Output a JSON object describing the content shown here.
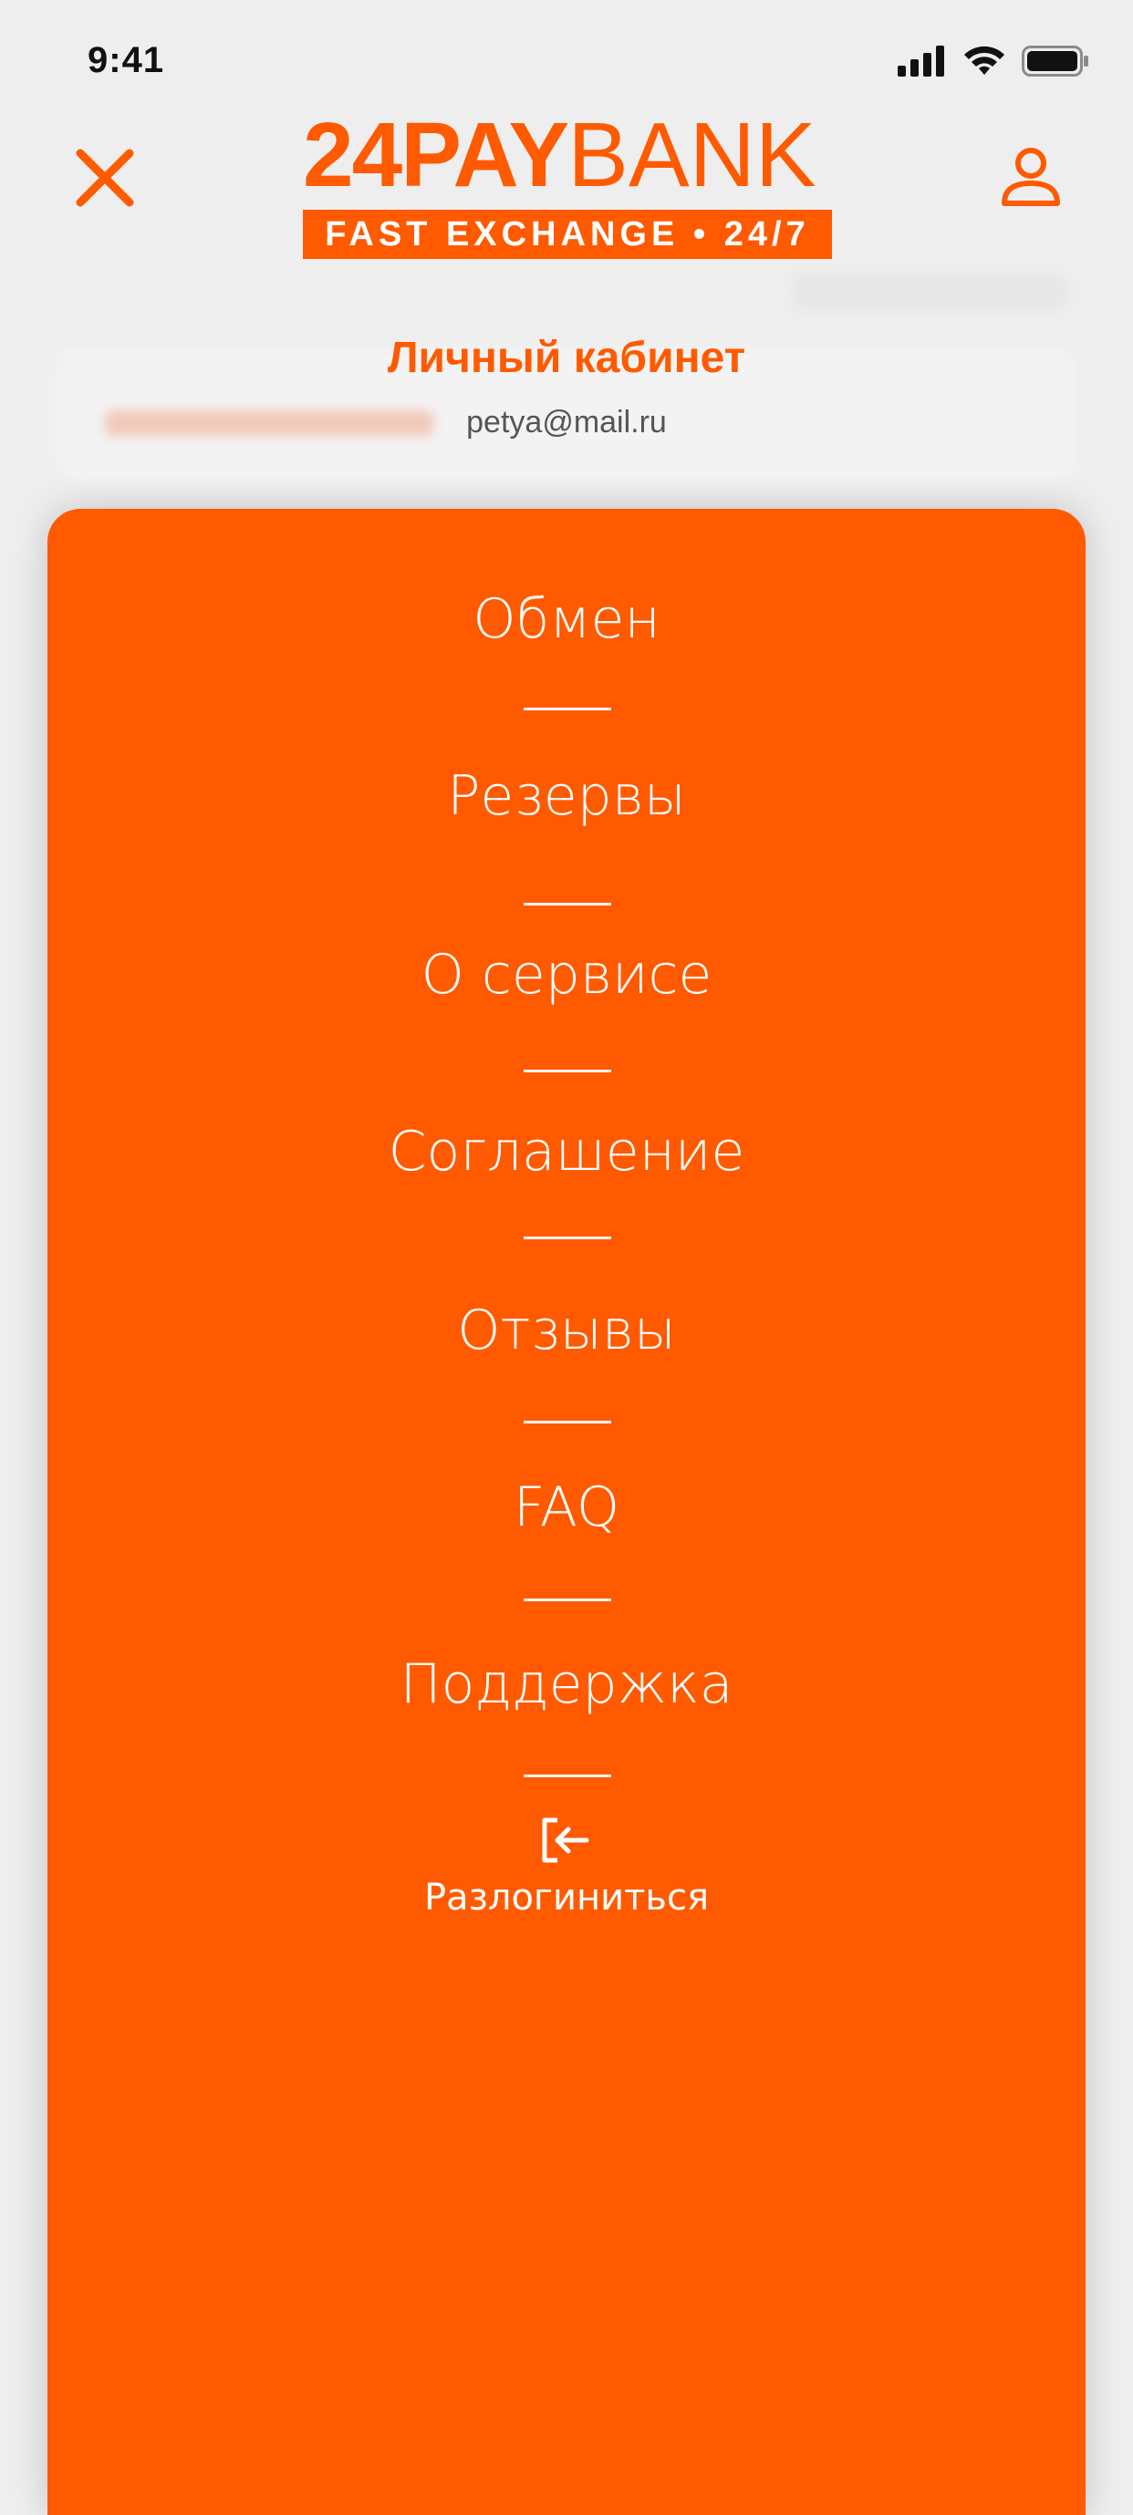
{
  "status_bar": {
    "time": "9:41",
    "icons": [
      "cellular-signal-icon",
      "wifi-icon",
      "battery-icon"
    ]
  },
  "header": {
    "logo": {
      "brand_bold": "24PAY",
      "brand_thin": "BANK",
      "tagline": "FAST EXCHANGE • 24/7"
    },
    "close_icon": "close-icon",
    "profile_icon": "user-icon"
  },
  "account": {
    "title": "Личный кабинет",
    "email": "petya@mail.ru"
  },
  "menu": {
    "items": [
      {
        "label": "Обмен"
      },
      {
        "label": "Резервы"
      },
      {
        "label": "О сервисе"
      },
      {
        "label": "Соглашение"
      },
      {
        "label": "Отзывы"
      },
      {
        "label": "FAQ"
      },
      {
        "label": "Поддержка"
      }
    ],
    "logout": {
      "label": "Разлогиниться",
      "icon": "logout-icon"
    }
  },
  "colors": {
    "accent": "#ff5a00",
    "menu_text": "#ffffff",
    "background": "#eeeeee"
  }
}
